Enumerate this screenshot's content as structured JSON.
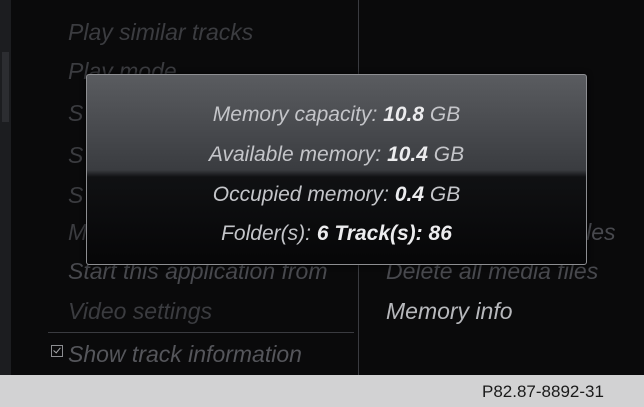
{
  "menu_left": {
    "items": [
      {
        "label": "Play similar tracks"
      },
      {
        "label": "Play mode"
      },
      {
        "label": "S"
      },
      {
        "label": "S"
      },
      {
        "label": "S"
      },
      {
        "label": "M"
      },
      {
        "label": "Start this application from"
      },
      {
        "label": "Video settings"
      },
      {
        "label": "Show track information"
      }
    ]
  },
  "menu_right": {
    "items": [
      {
        "label": "iles"
      },
      {
        "label": "Delete all media files"
      },
      {
        "label": "Memory info"
      }
    ]
  },
  "popup": {
    "capacity_label": "Memory capacity:",
    "capacity_value": "10.8",
    "capacity_unit": "GB",
    "available_label": "Available memory:",
    "available_value": "10.4",
    "available_unit": "GB",
    "occupied_label": "Occupied memory:",
    "occupied_value": "0.4",
    "occupied_unit": "GB",
    "folders_label": "Folder(s):",
    "folders_value": "6",
    "tracks_label": "Track(s):",
    "tracks_value": "86"
  },
  "footer": {
    "code": "P82.87-8892-31"
  }
}
